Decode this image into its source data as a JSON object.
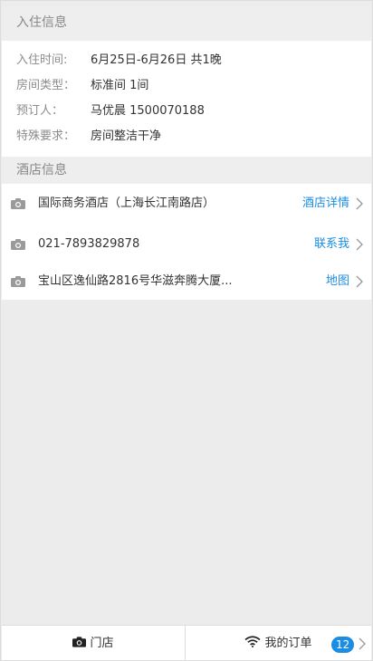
{
  "checkin_section": {
    "title": "入住信息",
    "rows": [
      {
        "label": "入住时间:",
        "value": "6月25日-6月26日   共1晚"
      },
      {
        "label": "房间类型：",
        "value": "标准间   1间"
      },
      {
        "label": "预订人：",
        "value": "马优晨   1500070188"
      },
      {
        "label": "特殊要求：",
        "value": "房间整洁干净"
      }
    ]
  },
  "hotel_section": {
    "title": "酒店信息",
    "rows": [
      {
        "text": "国际商务酒店（上海长江南路店）",
        "link": "酒店详情",
        "icon": "camera-icon"
      },
      {
        "text": "021-7893829878",
        "link": "联系我",
        "icon": "camera-icon"
      },
      {
        "text": "宝山区逸仙路2816号华滋奔腾大厦...",
        "link": "地图",
        "icon": "camera-icon"
      }
    ]
  },
  "bottom_bar": {
    "store_label": "门店",
    "orders_label": "我的订单",
    "orders_badge": "12"
  },
  "colors": {
    "accent": "#1b8ee3",
    "background": "#ececec",
    "label_gray": "#8c8c8c"
  }
}
